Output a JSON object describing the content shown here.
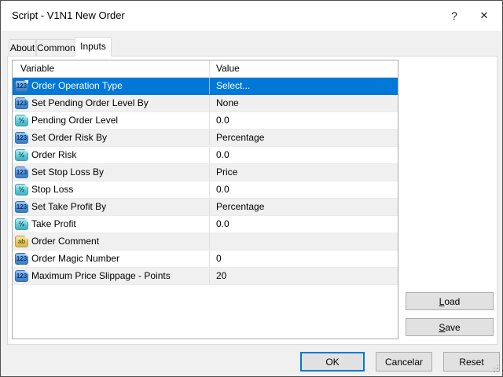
{
  "window": {
    "title": "Script - V1N1 New Order"
  },
  "titlebar": {
    "help_glyph": "?",
    "close_glyph": "✕"
  },
  "tabs": [
    {
      "label": "About",
      "active": false
    },
    {
      "label": "Common",
      "active": false
    },
    {
      "label": "Inputs",
      "active": true
    }
  ],
  "table": {
    "columns": [
      "Variable",
      "Value"
    ],
    "rows": [
      {
        "icon": "int",
        "variable": "Order Operation Type",
        "value": "Select...",
        "selected": true
      },
      {
        "icon": "int",
        "variable": "Set Pending Order Level By",
        "value": "None"
      },
      {
        "icon": "double",
        "variable": "Pending Order Level",
        "value": "0.0"
      },
      {
        "icon": "int",
        "variable": "Set Order Risk By",
        "value": "Percentage"
      },
      {
        "icon": "double",
        "variable": "Order Risk",
        "value": "0.0"
      },
      {
        "icon": "int",
        "variable": "Set Stop Loss By",
        "value": "Price"
      },
      {
        "icon": "double",
        "variable": "Stop Loss",
        "value": "0.0"
      },
      {
        "icon": "int",
        "variable": "Set Take Profit By",
        "value": "Percentage"
      },
      {
        "icon": "double",
        "variable": "Take Profit",
        "value": "0.0"
      },
      {
        "icon": "string",
        "variable": "Order Comment",
        "value": ""
      },
      {
        "icon": "int",
        "variable": "Order Magic Number",
        "value": "0"
      },
      {
        "icon": "int",
        "variable": "Maximum Price Slippage - Points",
        "value": "20"
      }
    ]
  },
  "icon_glyphs": {
    "int": "123",
    "double": "½",
    "string": "ab"
  },
  "buttons": {
    "load": "Load",
    "save": "Save",
    "ok": "OK",
    "cancel": "Cancelar",
    "reset": "Reset"
  },
  "colors": {
    "selection": "#0078d7"
  }
}
